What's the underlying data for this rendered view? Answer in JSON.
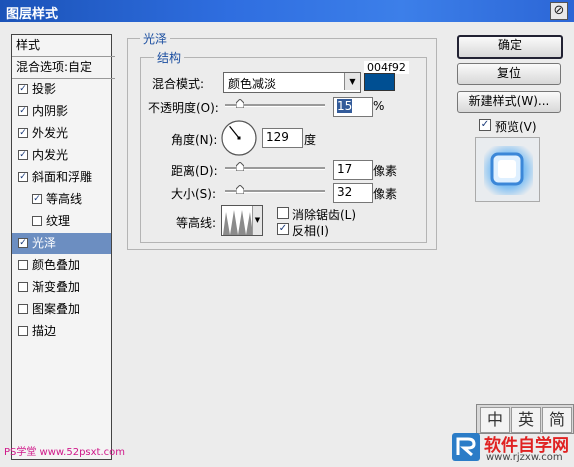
{
  "window": {
    "title": "图层样式",
    "close_icon": "close-icon"
  },
  "style_list": {
    "header": "样式",
    "blend_options": "混合选项:自定",
    "items": [
      {
        "label": "投影",
        "checked": true,
        "indent": false,
        "selected": false
      },
      {
        "label": "内阴影",
        "checked": true,
        "indent": false,
        "selected": false
      },
      {
        "label": "外发光",
        "checked": true,
        "indent": false,
        "selected": false
      },
      {
        "label": "内发光",
        "checked": true,
        "indent": false,
        "selected": false
      },
      {
        "label": "斜面和浮雕",
        "checked": true,
        "indent": false,
        "selected": false
      },
      {
        "label": "等高线",
        "checked": true,
        "indent": true,
        "selected": false
      },
      {
        "label": "纹理",
        "checked": false,
        "indent": true,
        "selected": false
      },
      {
        "label": "光泽",
        "checked": true,
        "indent": false,
        "selected": true
      },
      {
        "label": "颜色叠加",
        "checked": false,
        "indent": false,
        "selected": false
      },
      {
        "label": "渐变叠加",
        "checked": false,
        "indent": false,
        "selected": false
      },
      {
        "label": "图案叠加",
        "checked": false,
        "indent": false,
        "selected": false
      },
      {
        "label": "描边",
        "checked": false,
        "indent": false,
        "selected": false
      }
    ]
  },
  "satin": {
    "group_title": "光泽",
    "structure_title": "结构",
    "blend_mode_label": "混合模式:",
    "blend_mode_value": "颜色减淡",
    "color_hex": "004f92",
    "color_swatch": "#004f92",
    "opacity_label": "不透明度(O):",
    "opacity_value": "15",
    "opacity_unit": "%",
    "angle_label": "角度(N):",
    "angle_value": "129",
    "angle_unit": "度",
    "distance_label": "距离(D):",
    "distance_value": "17",
    "distance_unit": "像素",
    "size_label": "大小(S):",
    "size_value": "32",
    "size_unit": "像素",
    "contour_label": "等高线:",
    "antialias_label": "消除锯齿(L)",
    "antialias_checked": false,
    "invert_label": "反相(I)",
    "invert_checked": true
  },
  "buttons": {
    "ok": "确定",
    "reset": "复位",
    "new_style": "新建样式(W)...",
    "preview_label": "预览(V)",
    "preview_checked": true
  },
  "ime": {
    "keys": [
      "中",
      "英",
      "简"
    ]
  },
  "watermarks": {
    "left": "PS学堂 www.52psxt.com",
    "right_brand": "软件自学网",
    "right_url": "www.rjzxw.com"
  }
}
